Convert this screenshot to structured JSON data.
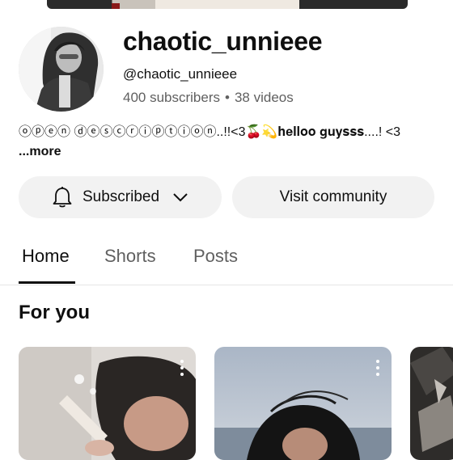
{
  "channel": {
    "name": "chaotic_unnieee",
    "handle": "@chaotic_unnieee",
    "subscribers": "400 subscribers",
    "separator": "•",
    "videos": "38 videos",
    "description": "ⓞⓟⓔⓝ ⓓⓔⓢⓒⓡⓘⓟⓣⓘⓞⓝ..!!<3🍒💫𝐡𝐞𝐥𝐥𝐨𝐨 𝐠𝐮𝐲𝐬𝐬𝐬....! <3",
    "more_label": "...more"
  },
  "actions": {
    "subscribed_label": "Subscribed",
    "visit_community_label": "Visit community"
  },
  "tabs": [
    {
      "label": "Home",
      "active": true
    },
    {
      "label": "Shorts",
      "active": false
    },
    {
      "label": "Posts",
      "active": false
    }
  ],
  "section": {
    "title": "For you"
  },
  "icons": {
    "bell": "bell-icon",
    "chevron": "chevron-down-icon",
    "kebab": "more-vert-icon"
  },
  "colors": {
    "button_bg": "#f2f2f2",
    "text_primary": "#0f0f0f",
    "text_secondary": "#606060"
  }
}
